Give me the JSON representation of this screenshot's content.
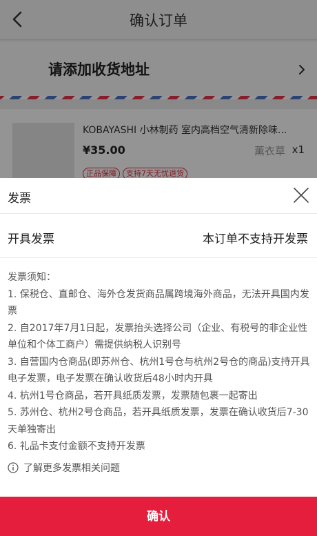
{
  "nav": {
    "title": "确认订单"
  },
  "address": {
    "label": "请添加收货地址"
  },
  "product": {
    "name": "KOBAYASHI 小林制药 室内高档空气清新除味...",
    "price": "¥35.00",
    "variant": "薰衣草",
    "qty": "x1",
    "tags": [
      "正品保障",
      "支持7天无忧退货"
    ]
  },
  "sheet": {
    "title": "发票",
    "invoice_label": "开具发票",
    "invoice_value": "本订单不支持开发票",
    "notice_title": "发票须知：",
    "notice_items": [
      "1. 保税仓、直邮仓、海外仓发货商品属跨境海外商品，无法开具国内发票",
      "2. 自2017年7月1日起，发票抬头选择公司（企业、有税号的非企业性单位和个体工商户）需提供纳税人识别号",
      "3. 自营国内仓商品(即苏州仓、杭州1号仓与杭州2号仓的商品)支持开具电子发票，电子发票在确认收货后48小时内开具",
      "4. 杭州1号仓商品，若开具纸质发票，发票随包裹一起寄出",
      "5. 苏州仓、杭州2号仓商品，若开具纸质发票，发票在确认收货后7-30天单独寄出",
      "6. 礼品卡支付金额不支持开发票"
    ],
    "more_link": "了解更多发票相关问题",
    "confirm_label": "确认"
  }
}
